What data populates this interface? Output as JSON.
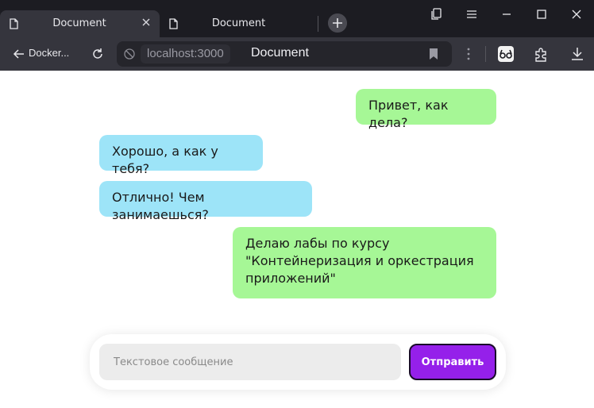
{
  "browser": {
    "tabs": [
      {
        "title": "Document",
        "active": true
      },
      {
        "title": "Document",
        "active": false
      }
    ],
    "back_label": "Docker...",
    "address": {
      "host": "localhost:3000",
      "page_title": "Document"
    },
    "colors": {
      "tabstrip": "#1c1c22",
      "toolbar": "#35353d"
    }
  },
  "chat": {
    "messages": [
      {
        "from": "me",
        "text": "Привет, как дела?"
      },
      {
        "from": "them",
        "text": "Хорошо, а как у тебя?"
      },
      {
        "from": "them",
        "text": "Отлично! Чем занимаешься?"
      },
      {
        "from": "me",
        "text": "Делаю лабы по курсу \"Контейнеризация и оркестрация приложений\""
      }
    ],
    "colors": {
      "me": "#a6f796",
      "them": "#9de4f8"
    }
  },
  "composer": {
    "placeholder": "Текстовое сообщение",
    "send_label": "Отправить",
    "send_color": "#9520ea"
  }
}
